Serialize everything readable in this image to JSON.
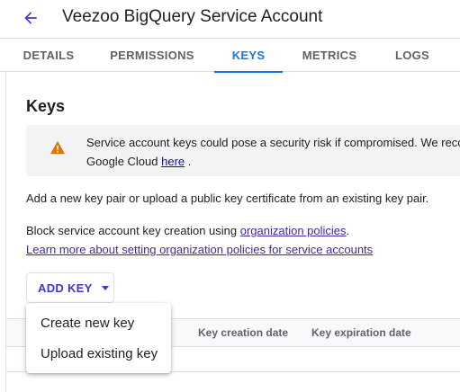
{
  "header": {
    "back_icon": "arrow-back-icon",
    "title": "Veezoo BigQuery Service Account"
  },
  "tabs": [
    {
      "label": "DETAILS",
      "active": false
    },
    {
      "label": "PERMISSIONS",
      "active": false
    },
    {
      "label": "KEYS",
      "active": true
    },
    {
      "label": "METRICS",
      "active": false
    },
    {
      "label": "LOGS",
      "active": false
    }
  ],
  "colors": {
    "accent": "#1a73e8",
    "warning_icon": "#e37400",
    "button_text": "#3f37c9"
  },
  "keys": {
    "title": "Keys",
    "warning": {
      "icon": "warning-triangle-icon",
      "line1": "Service account keys could pose a security risk if compromised. We recc",
      "line2_prefix": "Google Cloud ",
      "line2_link": "here",
      "line2_suffix": " ."
    },
    "description": "Add a new key pair or upload a public key certificate from an existing key pair.",
    "block_prefix": "Block service account key creation using ",
    "block_link": "organization policies",
    "block_suffix": ".",
    "learn_more_link": "Learn more about setting organization policies for service accounts",
    "add_key_label": "ADD KEY",
    "add_key_icon": "arrow-drop-down-icon",
    "menu": [
      {
        "label": "Create new key"
      },
      {
        "label": "Upload existing key"
      }
    ],
    "table": {
      "columns": [
        "Key creation date",
        "Key expiration date"
      ]
    }
  }
}
